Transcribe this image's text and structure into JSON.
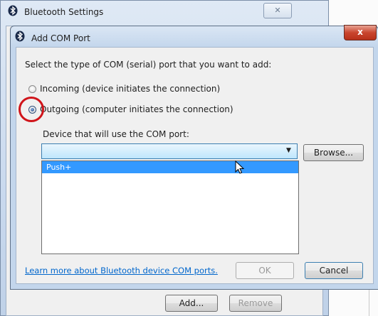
{
  "back_window": {
    "title": "Bluetooth Settings",
    "close_glyph": "✕",
    "add_label": "Add...",
    "remove_label": "Remove"
  },
  "dialog": {
    "title": "Add COM Port",
    "close_glyph": "x",
    "prompt": "Select the type of COM (serial) port that you want to add:",
    "incoming_label": "Incoming (device initiates the connection)",
    "outgoing_label": "Outgoing (computer initiates the connection)",
    "selected_option": "outgoing",
    "device_label": "Device that will use the COM port:",
    "device_combo_value": "",
    "dropdown_items": [
      "Push+"
    ],
    "browse_label": "Browse...",
    "learn_more_link": "Learn more about Bluetooth device COM ports.",
    "ok_label": "OK",
    "cancel_label": "Cancel"
  },
  "icons": {
    "bluetooth": "bluetooth-icon",
    "cursor": "mouse-pointer-icon",
    "dropdown": "chevron-down-icon"
  },
  "colors": {
    "selection": "#3399ff",
    "link": "#0066cc",
    "close_red": "#c9452e",
    "annotation_circle": "#d0141a"
  }
}
